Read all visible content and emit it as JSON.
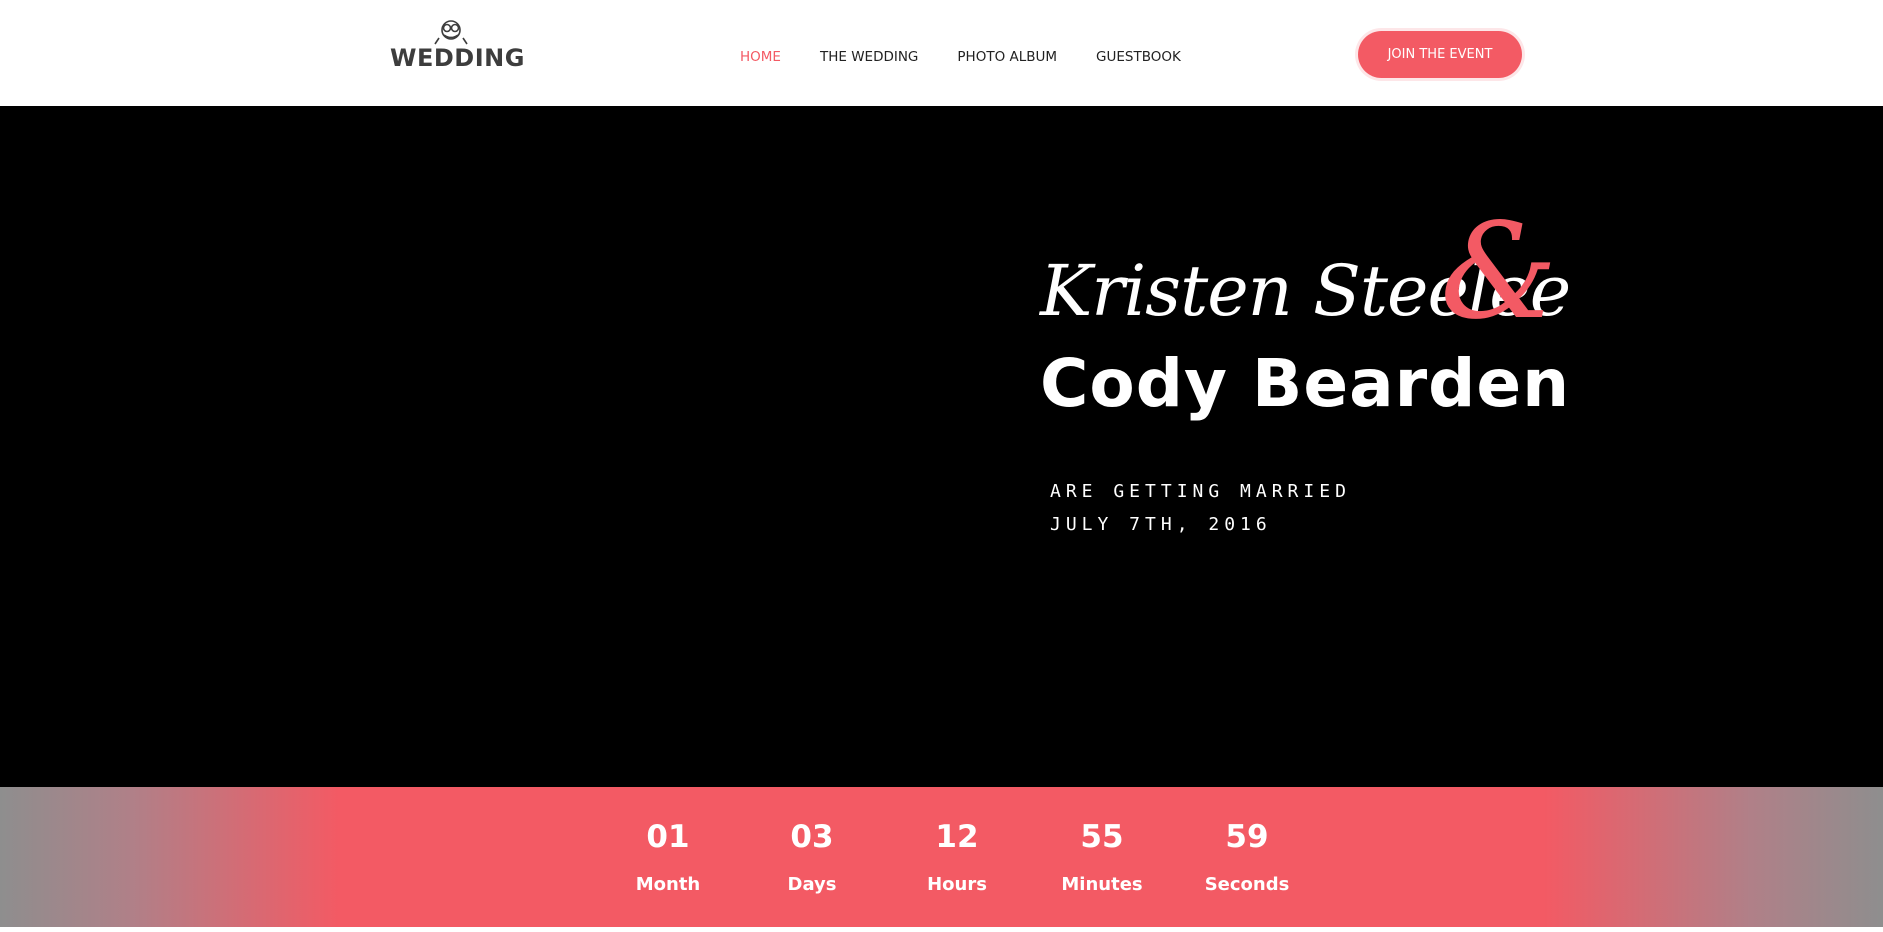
{
  "header": {
    "logo_text": "WEDDING",
    "nav": [
      {
        "label": "HOME",
        "active": true
      },
      {
        "label": "THE WEDDING",
        "active": false
      },
      {
        "label": "PHOTO ALBUM",
        "active": false
      },
      {
        "label": "GUESTBOOK",
        "active": false
      }
    ],
    "cta_label": "JOIN THE EVENT"
  },
  "hero": {
    "name_one": "Kristen Steelee",
    "ampersand": "&",
    "name_two": "Cody Bearden",
    "tagline": "ARE GETTING MARRIED",
    "date": "JULY 7TH, 2016"
  },
  "countdown": [
    {
      "value": "01",
      "label": "Month"
    },
    {
      "value": "03",
      "label": "Days"
    },
    {
      "value": "12",
      "label": "Hours"
    },
    {
      "value": "55",
      "label": "Minutes"
    },
    {
      "value": "59",
      "label": "Seconds"
    }
  ],
  "colors": {
    "accent": "#f35a64",
    "hero_bg": "#000000",
    "text_dark": "#222222"
  }
}
